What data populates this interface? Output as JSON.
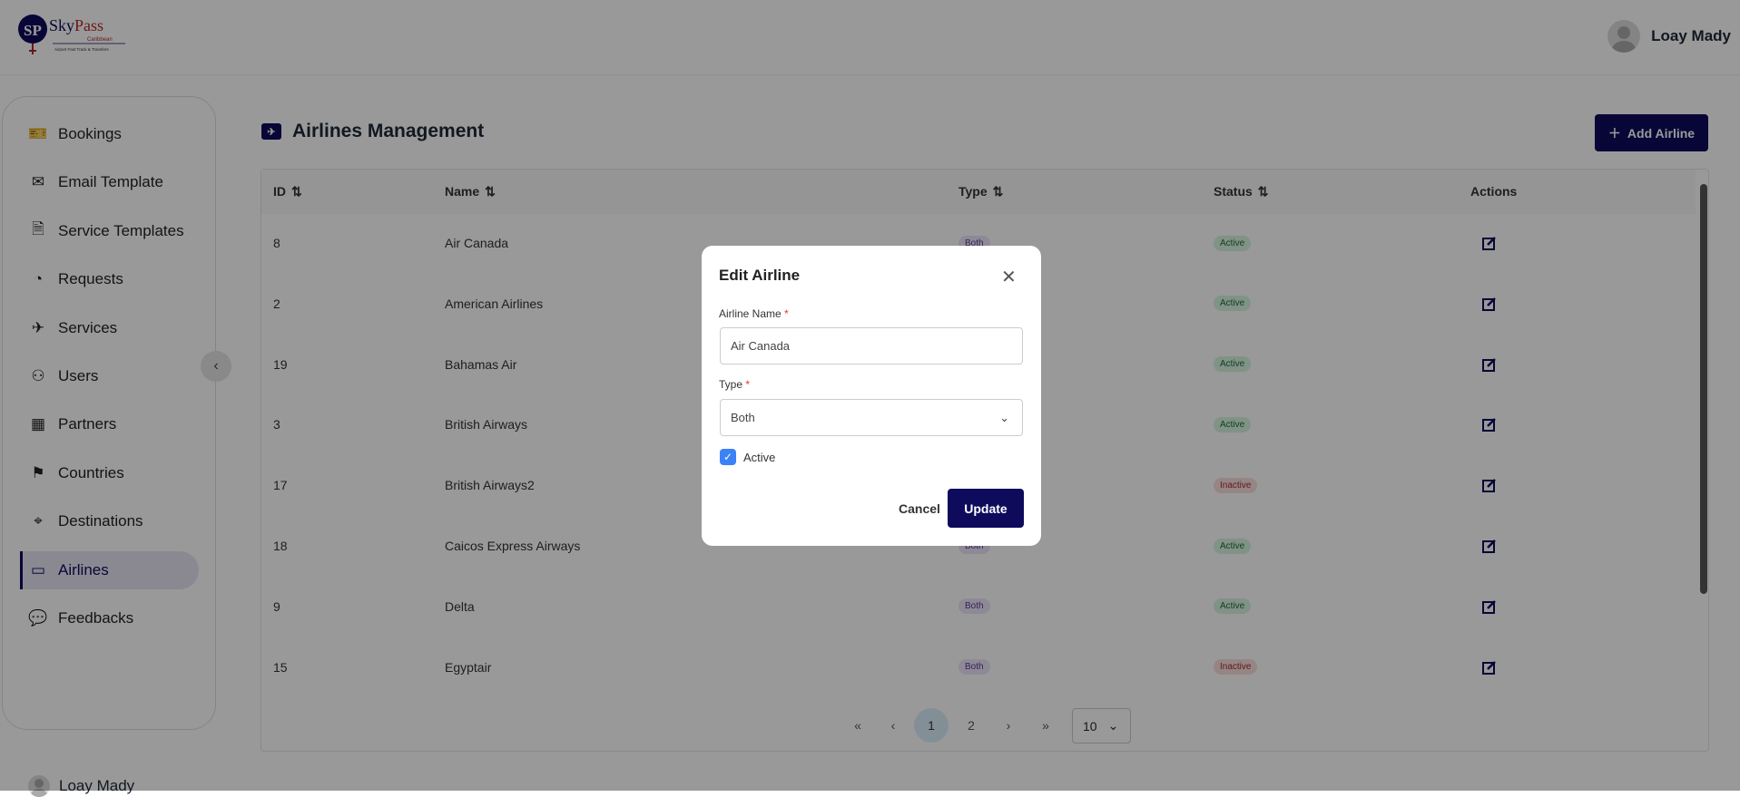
{
  "brand": {
    "name": "SkyPass",
    "sub": "Caribbean",
    "tagline": "Airport Fast Track & Transfers",
    "colors": {
      "primary": "#0e0a5c",
      "red": "#b3272d"
    }
  },
  "header": {
    "user_name": "Loay Mady"
  },
  "sidebar": {
    "items": [
      {
        "label": "Bookings",
        "icon": "ticket-icon"
      },
      {
        "label": "Email Template",
        "icon": "mail-icon"
      },
      {
        "label": "Service Templates",
        "icon": "document-icon"
      },
      {
        "label": "Requests",
        "icon": "request-icon"
      },
      {
        "label": "Services",
        "icon": "plane-icon"
      },
      {
        "label": "Users",
        "icon": "users-icon"
      },
      {
        "label": "Partners",
        "icon": "building-icon"
      },
      {
        "label": "Countries",
        "icon": "flag-icon"
      },
      {
        "label": "Destinations",
        "icon": "location-pin-icon"
      },
      {
        "label": "Airlines",
        "icon": "airline-ticket-icon",
        "active": true
      },
      {
        "label": "Feedbacks",
        "icon": "feedback-icon"
      }
    ],
    "user_name": "Loay Mady"
  },
  "page": {
    "title": "Airlines Management",
    "add_label": "Add Airline"
  },
  "table": {
    "columns": [
      "ID",
      "Name",
      "Type",
      "Status",
      "Actions"
    ],
    "rows": [
      {
        "id": "8",
        "name": "Air Canada",
        "type": "Both",
        "status": "Active"
      },
      {
        "id": "2",
        "name": "American Airlines",
        "type": "",
        "status": "Active"
      },
      {
        "id": "19",
        "name": "Bahamas Air",
        "type": "",
        "status": "Active"
      },
      {
        "id": "3",
        "name": "British Airways",
        "type": "",
        "status": "Active"
      },
      {
        "id": "17",
        "name": "British Airways2",
        "type": "",
        "status": "Inactive"
      },
      {
        "id": "18",
        "name": "Caicos Express Airways",
        "type": "Both",
        "status": "Active"
      },
      {
        "id": "9",
        "name": "Delta",
        "type": "Both",
        "status": "Active"
      },
      {
        "id": "15",
        "name": "Egyptair",
        "type": "Both",
        "status": "Inactive"
      }
    ]
  },
  "pagination": {
    "first": "«",
    "prev": "‹",
    "pages": [
      "1",
      "2"
    ],
    "current": "1",
    "next": "›",
    "last": "»",
    "page_size": "10"
  },
  "modal": {
    "title": "Edit Airline",
    "name_label": "Airline Name",
    "name_value": "Air Canada",
    "type_label": "Type",
    "type_value": "Both",
    "required": "*",
    "active_label": "Active",
    "active_checked": true,
    "cancel": "Cancel",
    "update": "Update"
  }
}
